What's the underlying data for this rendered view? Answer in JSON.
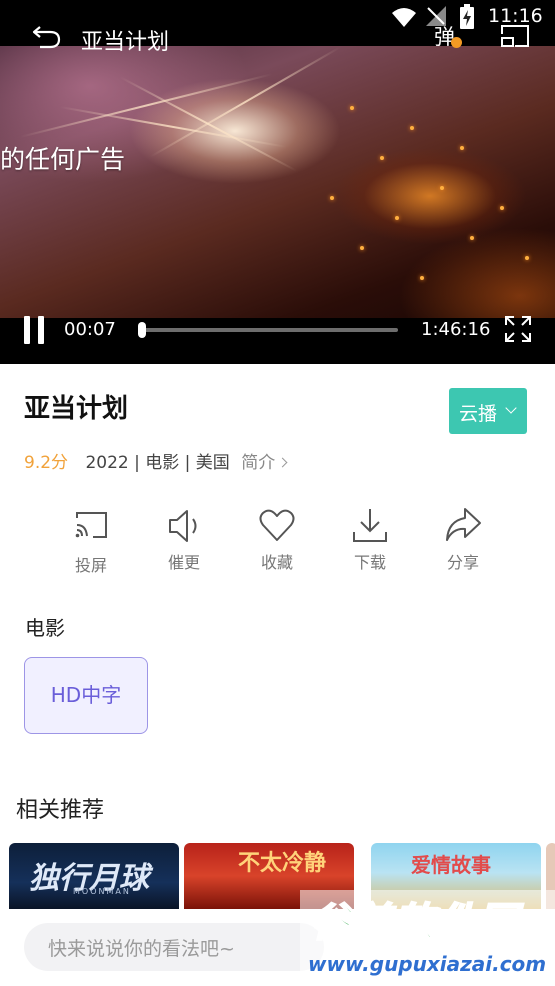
{
  "status_bar": {
    "time": "11:16"
  },
  "player": {
    "title": "亚当计划",
    "danmaku_label": "弹",
    "overlay_text": "的任何广告",
    "current_time": "00:07",
    "duration": "1:46:16",
    "progress": 0.0
  },
  "movie": {
    "title": "亚当计划",
    "source_button": "云播",
    "rating": "9.2分",
    "meta": "2022 | 电影 | 美国",
    "intro_link": "简介"
  },
  "actions": [
    {
      "label": "投屏",
      "icon": "cast-icon"
    },
    {
      "label": "催更",
      "icon": "speaker-icon"
    },
    {
      "label": "收藏",
      "icon": "heart-icon"
    },
    {
      "label": "下载",
      "icon": "download-icon"
    },
    {
      "label": "分享",
      "icon": "share-icon"
    }
  ],
  "episodes": {
    "section_title": "电影",
    "items": [
      "HD中字"
    ]
  },
  "related": {
    "section_title": "相关推荐",
    "posters": [
      {
        "title": "独行月球",
        "subtitle": "MOONMAN"
      },
      {
        "title": "不太冷静"
      },
      {
        "title": "爱情故事"
      }
    ]
  },
  "comment": {
    "placeholder": "快来说说你的看法吧~"
  },
  "watermark": {
    "line1": "谷普软件园",
    "line2": "www.gupuxiazai.com"
  },
  "colors": {
    "accent": "#3dc7b1",
    "rating": "#f1a23a",
    "episode_chip_text": "#6a5ed9",
    "episode_chip_border": "#9d95e6"
  }
}
